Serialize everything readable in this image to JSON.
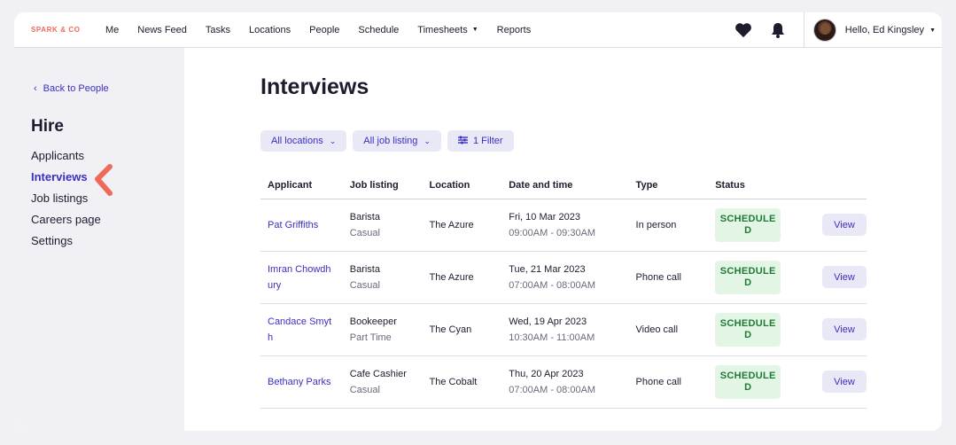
{
  "brand": "SPARK & CO",
  "nav": [
    {
      "label": "Me"
    },
    {
      "label": "News Feed"
    },
    {
      "label": "Tasks"
    },
    {
      "label": "Locations"
    },
    {
      "label": "People"
    },
    {
      "label": "Schedule"
    },
    {
      "label": "Timesheets",
      "dropdown": true
    },
    {
      "label": "Reports"
    }
  ],
  "user": {
    "greeting": "Hello, Ed Kingsley"
  },
  "sidebar": {
    "back_label": "Back to People",
    "title": "Hire",
    "items": [
      {
        "label": "Applicants"
      },
      {
        "label": "Interviews",
        "active": true
      },
      {
        "label": "Job listings"
      },
      {
        "label": "Careers page"
      },
      {
        "label": "Settings"
      }
    ]
  },
  "main": {
    "title": "Interviews",
    "filters": {
      "locations": "All locations",
      "job_listing": "All job listing",
      "filter": "1 Filter"
    },
    "columns": [
      "Applicant",
      "Job listing",
      "Location",
      "Date and time",
      "Type",
      "Status"
    ],
    "rows": [
      {
        "applicant": "Pat Griffiths",
        "job": "Barista",
        "job_type": "Casual",
        "location": "The Azure",
        "date": "Fri, 10 Mar 2023",
        "time": "09:00AM - 09:30AM",
        "type": "In person",
        "status_1": "SCHEDULE",
        "status_2": "D",
        "view": "View"
      },
      {
        "applicant": "Imran Chowdhury",
        "applicant_1": "Imran Chowdh",
        "applicant_2": "ury",
        "job": "Barista",
        "job_type": "Casual",
        "location": "The Azure",
        "date": "Tue, 21 Mar 2023",
        "time": "07:00AM - 08:00AM",
        "type": "Phone call",
        "status_1": "SCHEDULE",
        "status_2": "D",
        "view": "View"
      },
      {
        "applicant": "Candace Smyth",
        "applicant_1": "Candace Smyt",
        "applicant_2": "h",
        "job": "Bookeeper",
        "job_type": "Part Time",
        "location": "The Cyan",
        "date": "Wed, 19 Apr 2023",
        "time": "10:30AM - 11:00AM",
        "type": "Video call",
        "status_1": "SCHEDULE",
        "status_2": "D",
        "view": "View"
      },
      {
        "applicant": "Bethany Parks",
        "job": "Cafe Cashier",
        "job_type": "Casual",
        "location": "The Cobalt",
        "date": "Thu, 20 Apr 2023",
        "time": "07:00AM - 08:00AM",
        "type": "Phone call",
        "status_1": "SCHEDULE",
        "status_2": "D",
        "view": "View"
      }
    ]
  },
  "colors": {
    "accent": "#3b2ec2",
    "brand": "#f06a5c",
    "status_bg": "#e3f6e6",
    "status_text": "#1f7a35"
  }
}
